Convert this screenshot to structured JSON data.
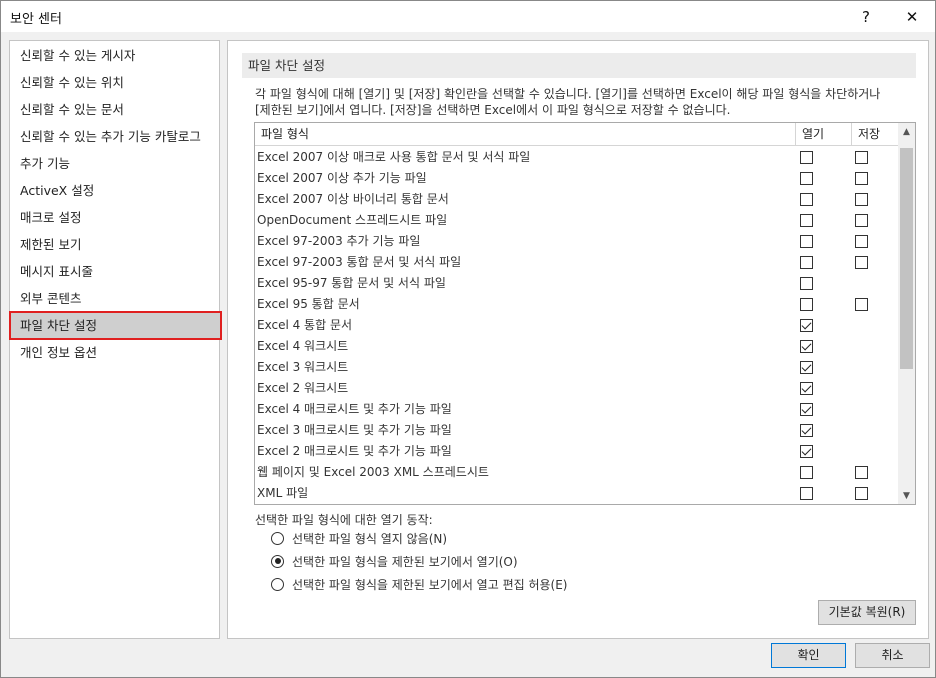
{
  "window": {
    "title": "보안 센터",
    "help_glyph": "?",
    "close_glyph": "✕"
  },
  "sidebar": {
    "items": [
      {
        "label": "신뢰할 수 있는 게시자"
      },
      {
        "label": "신뢰할 수 있는 위치"
      },
      {
        "label": "신뢰할 수 있는 문서"
      },
      {
        "label": "신뢰할 수 있는 추가 기능 카탈로그"
      },
      {
        "label": "추가 기능"
      },
      {
        "label": "ActiveX 설정"
      },
      {
        "label": "매크로 설정"
      },
      {
        "label": "제한된 보기"
      },
      {
        "label": "메시지 표시줄"
      },
      {
        "label": "외부 콘텐츠"
      },
      {
        "label": "파일 차단 설정",
        "selected": true
      },
      {
        "label": "개인 정보 옵션"
      }
    ]
  },
  "main": {
    "section_title": "파일 차단 설정",
    "description": "각 파일 형식에 대해 [열기] 및 [저장] 확인란을 선택할 수 있습니다. [열기]를 선택하면 Excel이 해당 파일 형식을 차단하거나 [제한된 보기]에서 엽니다. [저장]을 선택하면 Excel에서 이 파일 형식으로 저장할 수 없습니다.",
    "table": {
      "col_name": "파일 형식",
      "col_open": "열기",
      "col_save": "저장",
      "rows": [
        {
          "name": "Excel 2007 이상 매크로 사용 통합 문서 및 서식 파일",
          "open": false,
          "save": false
        },
        {
          "name": "Excel 2007 이상 추가 기능 파일",
          "open": false,
          "save": false
        },
        {
          "name": "Excel 2007 이상 바이너리 통합 문서",
          "open": false,
          "save": false
        },
        {
          "name": "OpenDocument 스프레드시트 파일",
          "open": false,
          "save": false
        },
        {
          "name": "Excel 97-2003 추가 기능 파일",
          "open": false,
          "save": false
        },
        {
          "name": "Excel 97-2003 통합 문서 및 서식 파일",
          "open": false,
          "save": false
        },
        {
          "name": "Excel 95-97 통합 문서 및 서식 파일",
          "open": false,
          "save": null
        },
        {
          "name": "Excel 95 통합 문서",
          "open": false,
          "save": false
        },
        {
          "name": "Excel 4 통합 문서",
          "open": true,
          "save": null
        },
        {
          "name": "Excel 4 워크시트",
          "open": true,
          "save": null
        },
        {
          "name": "Excel 3 워크시트",
          "open": true,
          "save": null
        },
        {
          "name": "Excel 2 워크시트",
          "open": true,
          "save": null
        },
        {
          "name": "Excel 4 매크로시트 및 추가 기능 파일",
          "open": true,
          "save": null
        },
        {
          "name": "Excel 3 매크로시트 및 추가 기능 파일",
          "open": true,
          "save": null
        },
        {
          "name": "Excel 2 매크로시트 및 추가 기능 파일",
          "open": true,
          "save": null
        },
        {
          "name": "웹 페이지 및 Excel 2003 XML 스프레드시트",
          "open": false,
          "save": false
        },
        {
          "name": "XML 파일",
          "open": false,
          "save": false
        }
      ]
    },
    "open_behavior": {
      "label": "선택한 파일 형식에 대한 열기 동작:",
      "options": [
        {
          "label": "선택한 파일 형식 열지 않음(N)",
          "selected": false
        },
        {
          "label": "선택한 파일 형식을 제한된 보기에서 열기(O)",
          "selected": true
        },
        {
          "label": "선택한 파일 형식을 제한된 보기에서 열고 편집 허용(E)",
          "selected": false
        }
      ]
    },
    "restore_defaults_label": "기본값 복원(R)"
  },
  "footer": {
    "ok_label": "확인",
    "cancel_label": "취소"
  }
}
